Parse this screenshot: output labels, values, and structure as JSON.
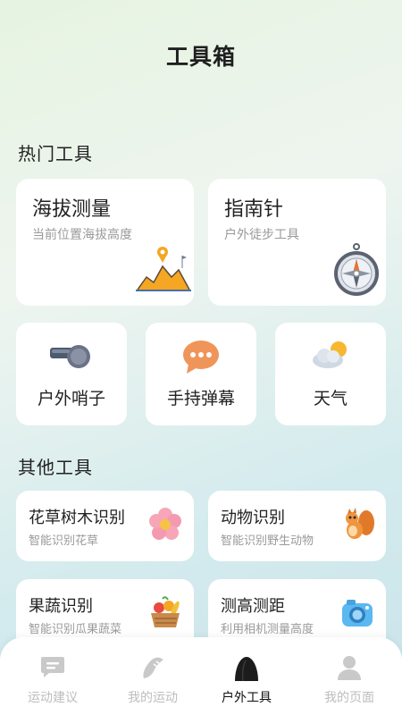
{
  "header": {
    "title": "工具箱"
  },
  "hot_section": {
    "title": "热门工具",
    "big_cards": [
      {
        "title": "海拔测量",
        "subtitle": "当前位置海拔高度",
        "icon": "altitude-mountain-icon"
      },
      {
        "title": "指南针",
        "subtitle": "户外徒步工具",
        "icon": "compass-icon"
      }
    ],
    "mid_cards": [
      {
        "label": "户外哨子",
        "icon": "whistle-icon"
      },
      {
        "label": "手持弹幕",
        "icon": "chat-bubble-icon"
      },
      {
        "label": "天气",
        "icon": "weather-icon"
      }
    ]
  },
  "other_section": {
    "title": "其他工具",
    "cards": [
      {
        "title": "花草树木识别",
        "subtitle": "智能识别花草",
        "icon": "flower-icon"
      },
      {
        "title": "动物识别",
        "subtitle": "智能识别野生动物",
        "icon": "squirrel-icon"
      },
      {
        "title": "果蔬识别",
        "subtitle": "智能识别瓜果蔬菜",
        "icon": "vegetable-basket-icon"
      },
      {
        "title": "测高测距",
        "subtitle": "利用相机测量高度",
        "icon": "camera-icon"
      }
    ]
  },
  "tabbar": {
    "items": [
      {
        "label": "运动建议",
        "icon": "message-icon",
        "active": false
      },
      {
        "label": "我的运动",
        "icon": "shoe-icon",
        "active": false
      },
      {
        "label": "户外工具",
        "icon": "rock-icon",
        "active": true
      },
      {
        "label": "我的页面",
        "icon": "person-icon",
        "active": false
      }
    ]
  },
  "colors": {
    "accent_orange": "#f5a623",
    "text_primary": "#222222",
    "text_secondary": "#9a9a9a",
    "tab_inactive": "#bdbdbd",
    "tab_active": "#111111"
  }
}
